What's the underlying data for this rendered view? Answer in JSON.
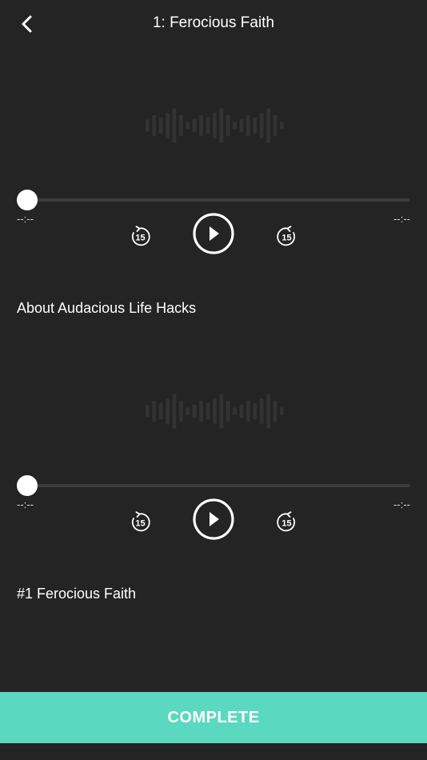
{
  "header": {
    "back_icon": "chevron-left-icon",
    "title": "1: Ferocious Faith"
  },
  "players": [
    {
      "progress": 0,
      "time_elapsed": "--:--",
      "time_remaining": "--:--",
      "rewind_label": "15",
      "forward_label": "15",
      "title": "About Audacious Life Hacks"
    },
    {
      "progress": 0,
      "time_elapsed": "--:--",
      "time_remaining": "--:--",
      "rewind_label": "15",
      "forward_label": "15",
      "title": "#1 Ferocious Faith"
    }
  ],
  "complete_button": {
    "label": "COMPLETE"
  },
  "colors": {
    "background": "#242424",
    "accent": "#5bd9c0",
    "waveform": "#333333",
    "track": "#3b3b3b",
    "text": "#ffffff"
  },
  "icons": {
    "rewind": "rewind-15-icon",
    "play": "play-icon",
    "forward": "forward-15-icon"
  }
}
